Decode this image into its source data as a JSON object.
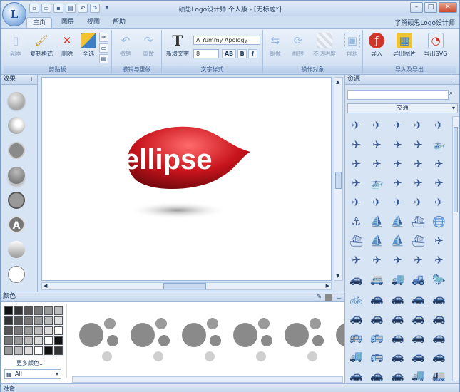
{
  "window": {
    "title": "硕思Logo设计师 个人版 - [无标题*]",
    "help_link": "了解硕思Logo设计师",
    "app_letter": "L"
  },
  "tabs": [
    {
      "label": "主页",
      "active": true
    },
    {
      "label": "图层",
      "active": false
    },
    {
      "label": "视图",
      "active": false
    },
    {
      "label": "帮助",
      "active": false
    }
  ],
  "ribbon": {
    "groups": {
      "clipboard": "剪贴板",
      "undo": "撤销与重做",
      "text": "文字样式",
      "operate": "操作对象",
      "io": "导入及导出"
    },
    "buttons": {
      "copy": "副本",
      "format_painter": "复制格式",
      "delete": "删除",
      "select_all": "全选",
      "undo": "撤销",
      "redo": "重做",
      "new_text": "新增文字",
      "mirror": "镜像",
      "rotate": "翻转",
      "opacity": "不透明度",
      "group": "群组",
      "import": "导入",
      "export_image": "导出图片",
      "export_svg": "导出SVG"
    },
    "font_name": "A Yummy Apology",
    "font_size": "8"
  },
  "panels": {
    "effects": "效果",
    "colors": "颜色",
    "resources": "资源",
    "more_colors": "更多颜色...",
    "color_filter": "All",
    "resource_category": "交通",
    "search_icon": "search-icon"
  },
  "logo": {
    "text": "ellipse",
    "color": "#c8141c"
  },
  "status": "准备"
}
